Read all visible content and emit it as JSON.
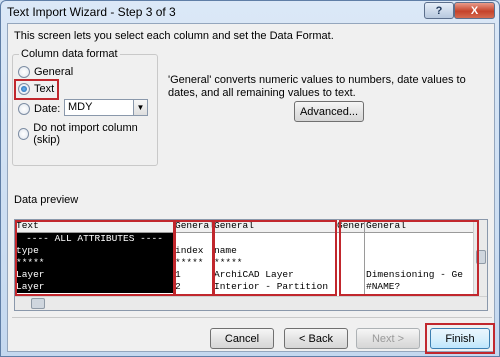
{
  "window": {
    "title": "Text Import Wizard - Step 3 of 3",
    "help_label": "?",
    "close_label": "X"
  },
  "description": "This screen lets you select each column and set the Data Format.",
  "column_format": {
    "group_label": "Column data format",
    "options": [
      {
        "label": "General",
        "checked": false
      },
      {
        "label": "Text",
        "checked": true
      },
      {
        "label": "Date:",
        "checked": false
      },
      {
        "label": "Do not import column (skip)",
        "checked": false
      }
    ],
    "date_value": "MDY"
  },
  "info_text": "'General' converts numeric values to numbers, date values to dates, and all remaining values to text.",
  "advanced_label": "Advanced...",
  "preview": {
    "label": "Data preview",
    "columns": [
      {
        "header": "Text",
        "cells": [
          "---- ALL ATTRIBUTES ----",
          "type",
          "*****",
          "Layer",
          "Layer"
        ]
      },
      {
        "header": "General",
        "cells": [
          "",
          "index",
          "*****",
          "1",
          "2"
        ]
      },
      {
        "header": "General",
        "cells": [
          "",
          "name",
          "*****",
          "ArchiCAD Layer",
          "Interior - Partition"
        ]
      },
      {
        "header": "General",
        "cells": [
          "",
          "",
          "",
          "",
          ""
        ]
      },
      {
        "header": "General",
        "cells": [
          "",
          "",
          "",
          "Dimensioning - Ge",
          "#NAME?"
        ]
      }
    ]
  },
  "buttons": {
    "cancel": "Cancel",
    "back": "< Back",
    "next": "Next >",
    "finish": "Finish"
  },
  "highlight_color": "#c1272d"
}
